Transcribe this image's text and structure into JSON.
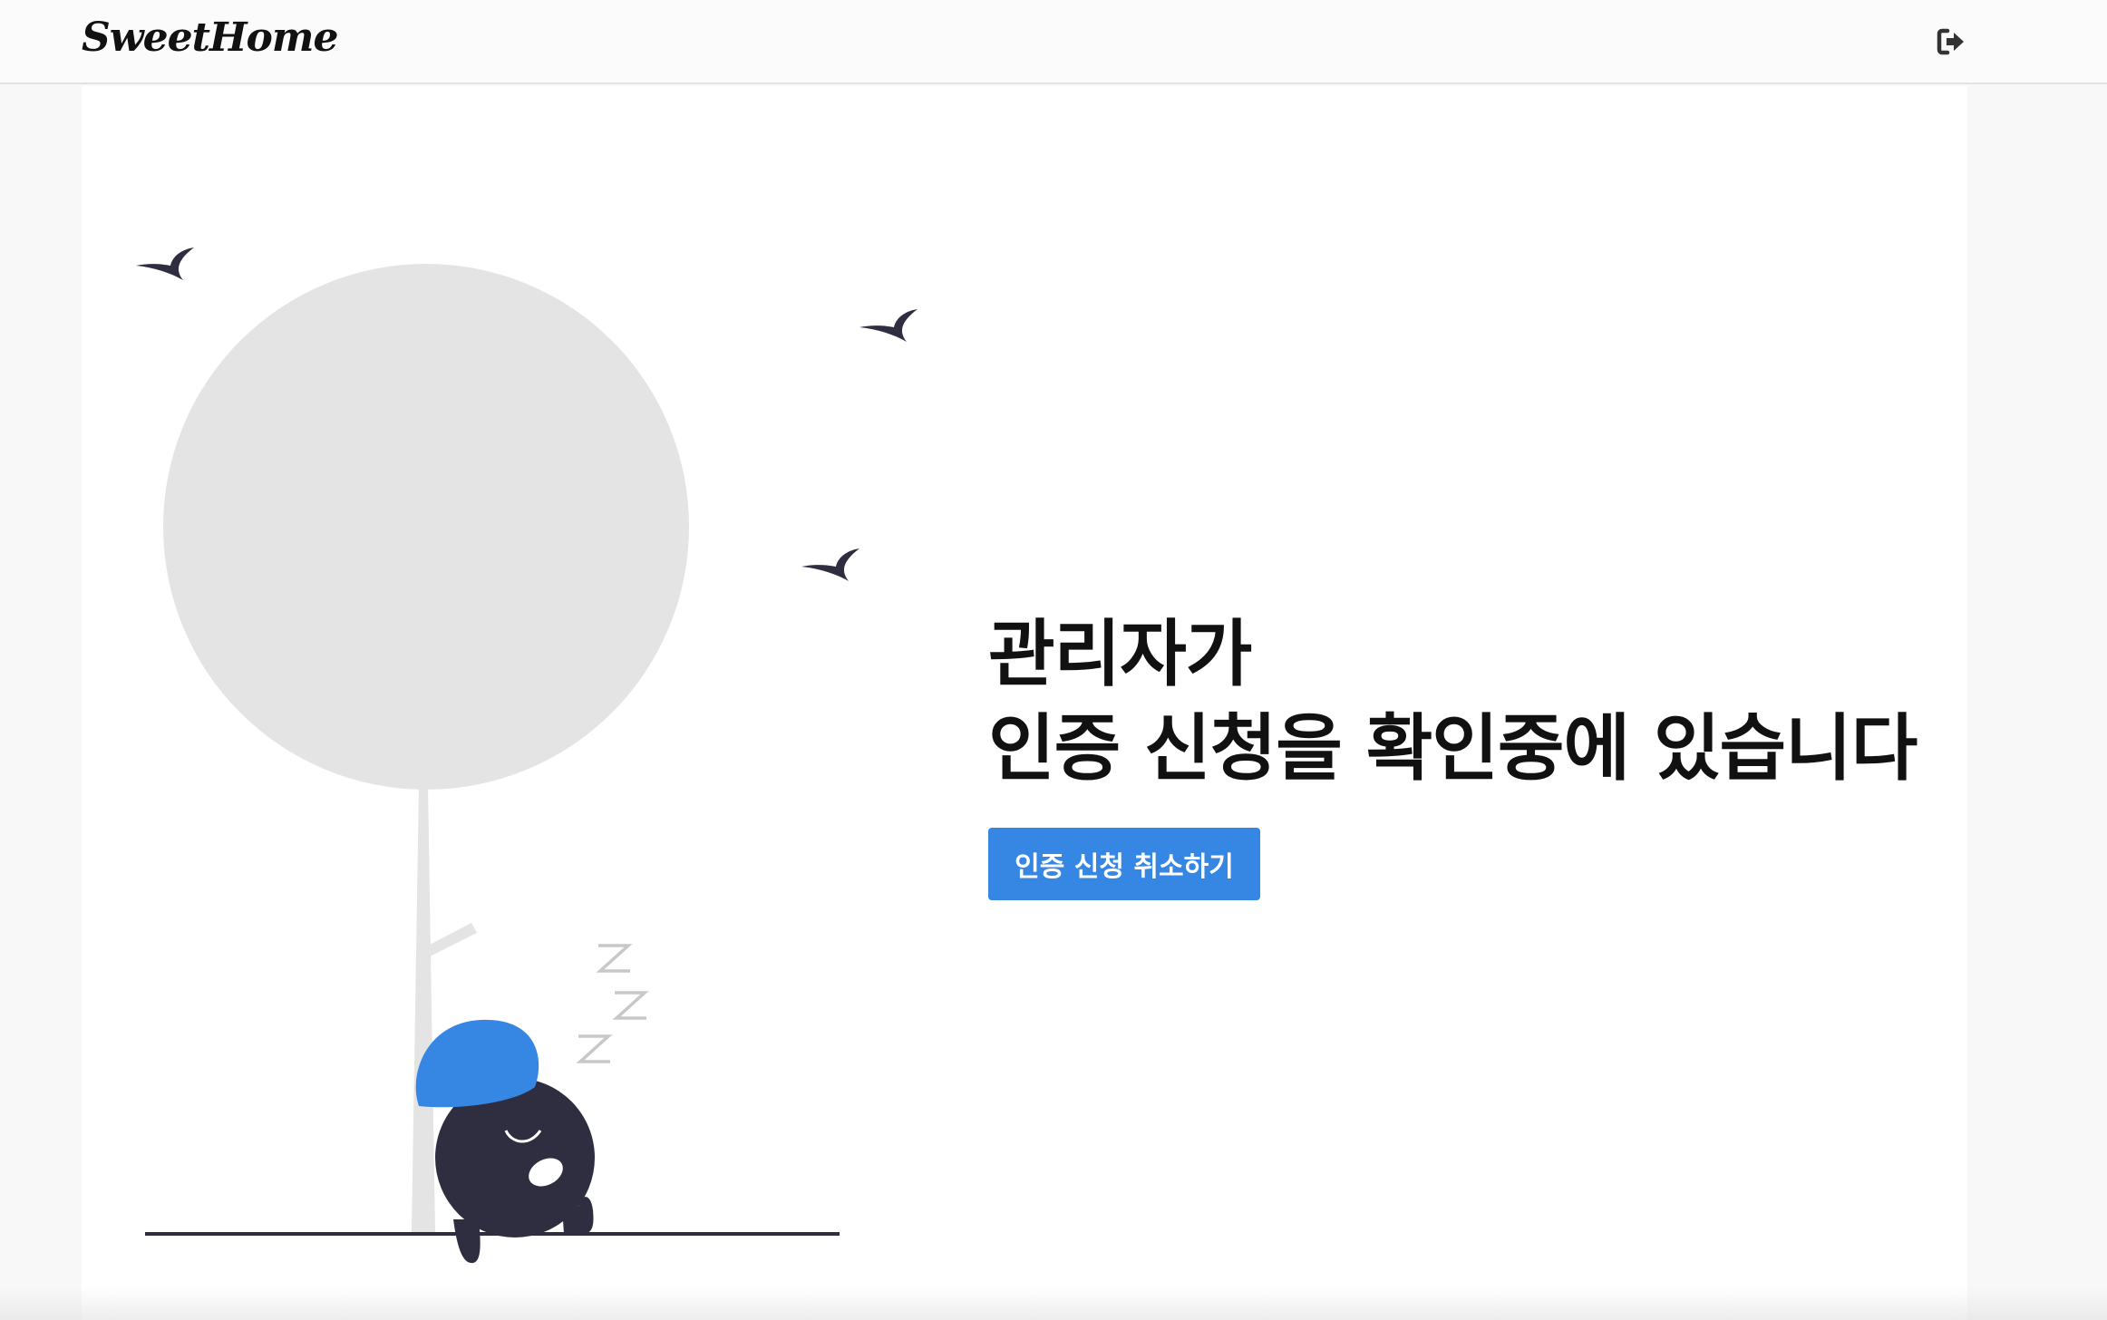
{
  "header": {
    "logo_text": "SweetHome",
    "logout_icon": "sign-out-icon"
  },
  "main": {
    "message_line1": "관리자가",
    "message_line2": "인증 신청을 확인중에 있습니다",
    "cancel_button_label": "인증 신청 취소하기"
  },
  "illustration": {
    "name": "sleeping-character-under-tree",
    "zzz": [
      "Z",
      "Z",
      "Z"
    ]
  },
  "colors": {
    "accent": "#3587e3",
    "dark": "#2f2e41",
    "tree": "#e4e4e4",
    "zzz": "#c8c8c8",
    "text": "#111111"
  }
}
